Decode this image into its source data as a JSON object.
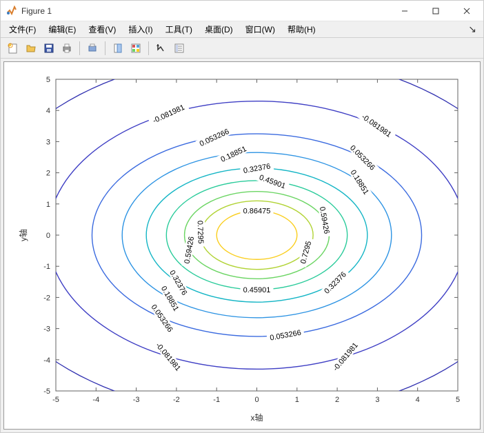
{
  "window": {
    "title": "Figure 1"
  },
  "menu": {
    "file": "文件(F)",
    "edit": "编辑(E)",
    "view": "查看(V)",
    "insert": "插入(I)",
    "tools": "工具(T)",
    "desktop": "桌面(D)",
    "window_menu": "窗口(W)",
    "help": "帮助(H)"
  },
  "toolbar_icons": {
    "new": "new-figure-icon",
    "open": "open-icon",
    "save": "save-icon",
    "print": "print-icon",
    "print_preview": "print-preview-icon",
    "link": "link-icon",
    "legend": "legend-icon",
    "edit_plot": "edit-plot-icon",
    "insert_colorbar": "insert-colorbar-icon"
  },
  "axes": {
    "xlabel": "x轴",
    "ylabel": "y轴",
    "xticks": [
      "-5",
      "-4",
      "-3",
      "-2",
      "-1",
      "0",
      "1",
      "2",
      "3",
      "4",
      "5"
    ],
    "yticks": [
      "-5",
      "-4",
      "-3",
      "-2",
      "-1",
      "0",
      "1",
      "2",
      "3",
      "4",
      "5"
    ]
  },
  "chart_data": {
    "type": "contour",
    "title": "",
    "xlabel": "x轴",
    "ylabel": "y轴",
    "x_range": [
      -5,
      5
    ],
    "y_range": [
      -5,
      5
    ],
    "levels": [
      -0.081981,
      0.053266,
      0.18851,
      0.32376,
      0.45901,
      0.59426,
      0.7295,
      0.86475
    ],
    "level_colors": [
      "#3e3ec4",
      "#3a6adf",
      "#2c93e3",
      "#14b5c5",
      "#29cb9a",
      "#6bd563",
      "#b1d334",
      "#face1e"
    ],
    "approx_radius_x": [
      5.2,
      4.1,
      3.35,
      2.75,
      2.25,
      1.8,
      1.4,
      1.0
    ],
    "approx_radius_y": [
      4.3,
      3.25,
      2.65,
      2.15,
      1.75,
      1.4,
      1.1,
      0.78
    ],
    "label_placements": [
      {
        "text": "-0.081981",
        "x_idx": 0
      },
      {
        "text": "0.053266",
        "x_idx": 1
      },
      {
        "text": "0.18851",
        "x_idx": 2
      },
      {
        "text": "0.32376",
        "x_idx": 3
      },
      {
        "text": "0.45901",
        "x_idx": 4
      },
      {
        "text": "0.59426",
        "x_idx": 5
      },
      {
        "text": "0.7295",
        "x_idx": 6
      },
      {
        "text": "0.86475",
        "x_idx": 7
      }
    ]
  }
}
